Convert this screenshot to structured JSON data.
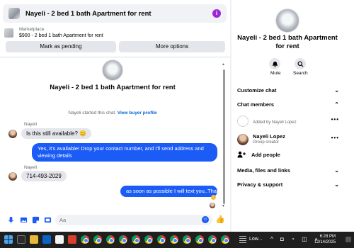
{
  "header": {
    "title": "Nayeli - 2 bed 1 bath Apartment for rent",
    "info_icon": "i"
  },
  "marketplace": {
    "kicker": "Marketplace",
    "listing": "$900 - 2 bed 1 bath Apartment for rent"
  },
  "actions": {
    "pending_label": "Mark as pending",
    "more_label": "More options"
  },
  "conversation": {
    "title": "Nayeli - 2 bed 1 bath Apartment for rent",
    "started_prefix": "Nayeli started this chat.",
    "started_link": "View buyer profile",
    "messages": [
      {
        "sender": "Nayeli",
        "text": "Is this still available?",
        "emoji": "😊"
      },
      {
        "sender": "me",
        "text": "Yes, it's available! Drop your contact number, and I'll send address and viewing details"
      },
      {
        "sender": "Nayeli",
        "text": "714-493-2029"
      },
      {
        "sender": "me",
        "text": "as soon as possible I will text you..Thanks"
      }
    ]
  },
  "composer": {
    "placeholder": "Aa"
  },
  "details": {
    "title": "Nayeli - 2 bed 1 bath Apartment for rent",
    "mute_label": "Mute",
    "search_label": "Search",
    "sections": {
      "customize": "Customize chat",
      "members": "Chat members",
      "media": "Media, files and links",
      "privacy": "Privacy & support"
    },
    "members": [
      {
        "name": "",
        "sub": "Added by Nayeli Lopez"
      },
      {
        "name": "Nayeli Lopez",
        "sub": "Group creator"
      }
    ],
    "add_people": "Add people"
  },
  "taskbar": {
    "weather_text": "Low...",
    "time": "6:28 PM",
    "date": "12/14/2025"
  },
  "colors": {
    "accent": "#1a5cf5",
    "info": "#9b27d6"
  }
}
